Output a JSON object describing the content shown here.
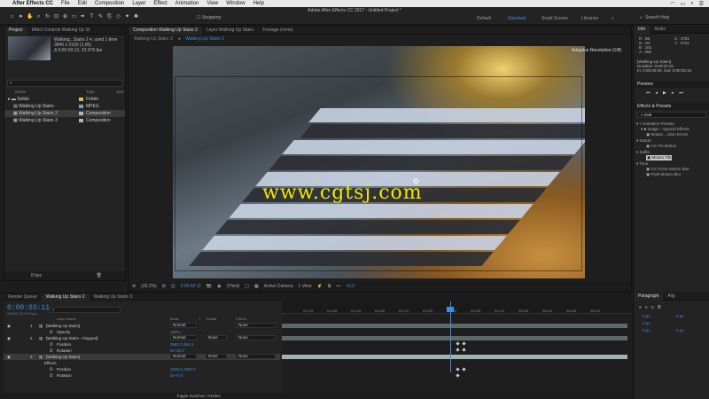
{
  "menubar": {
    "app_name": "After Effects CC",
    "items": [
      "File",
      "Edit",
      "Composition",
      "Layer",
      "Effect",
      "Animation",
      "View",
      "Window",
      "Help"
    ]
  },
  "window_title": "Adobe After Effects CC 2017 - Untitled Project *",
  "toolbar": {
    "snapping_label": "Snapping",
    "workspaces": [
      "Default",
      "Standard",
      "Small Screen",
      "Libraries"
    ],
    "active_workspace": "Standard",
    "search_help_placeholder": "Search Help"
  },
  "project_panel": {
    "tabs": [
      "Project",
      "Effect Controls Walking Up St"
    ],
    "selected_item_name": "Walking...Stairs 2 ▾, used 1 time",
    "selected_item_size": "3840 x 2160 (1.00)",
    "selected_item_duration": "Δ 0;00:09:13, 23.976 fps",
    "search_placeholder": "",
    "columns": [
      "Name",
      "Type",
      "Size"
    ],
    "items": [
      {
        "name": "Solids",
        "type": "Folder",
        "color": "#d6c04a"
      },
      {
        "name": "Walking Up Stairs",
        "type": "MPEG",
        "color": "#6aa6c9"
      },
      {
        "name": "Walking Up Stairs 2",
        "type": "Composition",
        "color": "#b5b5b5",
        "selected": true
      },
      {
        "name": "Walking Up Stairs 3",
        "type": "Composition",
        "color": "#b5b5b5"
      }
    ],
    "footer_bpc": "8 bpc"
  },
  "comp_panel": {
    "tabs": [
      "Composition Walking Up Stairs 2",
      "Layer Walking Up Stairs",
      "Footage (none)"
    ],
    "subtabs": [
      "Walking Up Stairs 3",
      "Walking Up Stairs 2"
    ],
    "active_subtab": "Walking Up Stairs 2",
    "adaptive_resolution": "Adaptive Resolution (1/8)",
    "watermark": "www.cgtsj.com",
    "footer": {
      "zoom": "(29.2%)",
      "timecode": "0:00:03:11",
      "resolution": "(Third)",
      "camera": "Active Camera",
      "views": "1 View",
      "exposure": "+0.0"
    }
  },
  "info_panel": {
    "tabs": [
      "Info",
      "Audio"
    ],
    "r": "R : 88",
    "g": "G : 84",
    "b": "B : 101",
    "a": "A : 255",
    "x": "X : 1701",
    "y": "Y : 1721",
    "layer_name": "[Walking Up Stairs]",
    "duration": "Duration: 0:00:03:16",
    "in_out": "In: 0:00:00:00, Out: 0:00:03:15"
  },
  "preview_panel": {
    "title": "Preview"
  },
  "effects_panel": {
    "title": "Effects & Presets",
    "search_value": "moti",
    "entries": [
      {
        "text": "▾ * Animation Presets",
        "indent": 0
      },
      {
        "text": "▾ ■ Image – Special Effects",
        "indent": 1
      },
      {
        "text": "▣ Motion ...otion Errors",
        "indent": 2
      },
      {
        "text": "▾ Distort",
        "indent": 0
      },
      {
        "text": "▣ CC Flo Motion",
        "indent": 2
      },
      {
        "text": "▾ Sufila",
        "indent": 0
      },
      {
        "text": "▣ Motion Tile",
        "indent": 2,
        "highlight": true
      },
      {
        "text": "▾ Time",
        "indent": 0
      },
      {
        "text": "▣ CC Force Motion Blur",
        "indent": 2
      },
      {
        "text": "▣ Pixel Motion Blur",
        "indent": 2
      }
    ]
  },
  "timeline": {
    "tabs": [
      "Render Queue",
      "Walking Up Stairs 2",
      "Walking Up Stairs 3"
    ],
    "current_time": "0:00:03:11",
    "fps_note": "00083 (23.976 fps)",
    "columns": [
      "Layer Name",
      "Mode",
      "T",
      "TrkMat",
      "Parent"
    ],
    "ruler": [
      "00:12f",
      "01:00f",
      "01:12f",
      "02:00f",
      "02:12f",
      "03:00f",
      "03:12f",
      "04:00f",
      "04:12f",
      "05:00f",
      "05:12f",
      "06:00f",
      "06:12f"
    ],
    "rows": [
      {
        "num": "1",
        "name": "[Walking Up Stairs]",
        "mode": "Normal",
        "trk": "",
        "parent": "None",
        "kind": "layer"
      },
      {
        "name": "Opacity",
        "value": "100%",
        "kind": "prop"
      },
      {
        "num": "2",
        "name": "[Walking Up Stairs - Flopped]",
        "mode": "Normal",
        "trk": "None",
        "parent": "None",
        "kind": "layer"
      },
      {
        "name": "Position",
        "value": "2582.0,364.0",
        "kind": "prop"
      },
      {
        "name": "Rotation",
        "value": "0x-33.0°",
        "kind": "prop"
      },
      {
        "num": "3",
        "name": "[Walking Up Stairs]",
        "mode": "Normal",
        "trk": "None",
        "parent": "None",
        "kind": "layer",
        "selected": true
      },
      {
        "name": "Effects",
        "kind": "group"
      },
      {
        "name": "Position",
        "value": "1920.0,1080.0",
        "kind": "prop"
      },
      {
        "name": "Rotation",
        "value": "0x+0.0°",
        "kind": "prop"
      }
    ],
    "toggle_label": "Toggle Switches / Modes"
  },
  "paragraph_panel": {
    "tabs": [
      "Paragraph",
      "Alig"
    ],
    "px_values": [
      "0 px",
      "0 px",
      "0 px",
      "0 px",
      "0 px"
    ]
  }
}
